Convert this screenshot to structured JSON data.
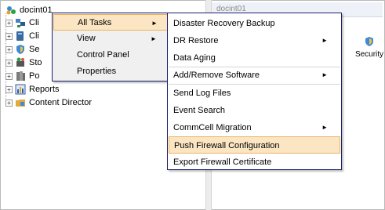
{
  "tree": {
    "root": {
      "label": "docint01"
    },
    "items": [
      {
        "label": "Cli",
        "icon": "client-computer-group-icon",
        "color": "#4a7fc0"
      },
      {
        "label": "Cli",
        "icon": "client-computers-icon",
        "color": "#3a6a9e"
      },
      {
        "label": "Se",
        "icon": "security-shield-icon",
        "color": "#3e89d8"
      },
      {
        "label": "Sto",
        "icon": "storage-resources-icon",
        "color": "#555555"
      },
      {
        "label": "Po",
        "icon": "policies-icon",
        "color": "#7a7a7a"
      },
      {
        "label": "Reports",
        "icon": "reports-icon",
        "color": "#2f5fa8"
      },
      {
        "label": "Content Director",
        "icon": "content-director-folder-icon",
        "color": "#e3a93a"
      }
    ]
  },
  "right_pane": {
    "title": "docint01",
    "security_label": "Security"
  },
  "context_menu": {
    "items": [
      {
        "label": "All Tasks",
        "has_submenu": true,
        "highlighted": true
      },
      {
        "label": "View",
        "has_submenu": true,
        "highlighted": false
      },
      {
        "label": "Control Panel",
        "has_submenu": false,
        "highlighted": false
      },
      {
        "label": "Properties",
        "has_submenu": false,
        "highlighted": false
      }
    ]
  },
  "submenu": {
    "items": [
      {
        "label": "Disaster Recovery Backup",
        "has_submenu": false
      },
      {
        "label": "DR Restore",
        "has_submenu": true
      },
      {
        "label": "Data Aging",
        "has_submenu": false
      },
      {
        "label": "Add/Remove Software",
        "has_submenu": true
      },
      {
        "label": "Send Log Files",
        "has_submenu": false
      },
      {
        "label": "Event Search",
        "has_submenu": false
      },
      {
        "label": "CommCell Migration",
        "has_submenu": true
      },
      {
        "label": "Push Firewall Configuration",
        "has_submenu": false,
        "highlighted": true
      },
      {
        "label": "Export Firewall Certificate",
        "has_submenu": false
      }
    ],
    "arrow_glyph": "►"
  },
  "colors": {
    "menu_border": "#1b1f6d",
    "highlight_bg": "#fbe5c2",
    "highlight_border": "#e9b562"
  }
}
